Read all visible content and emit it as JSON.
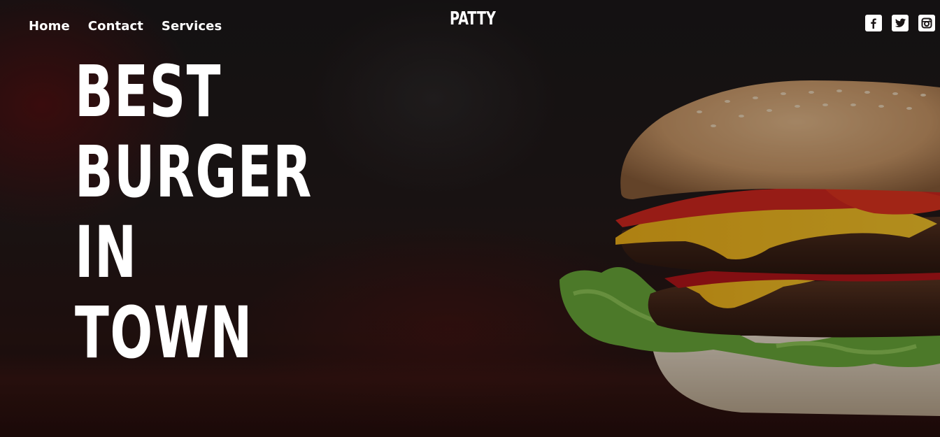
{
  "nav": {
    "items": [
      {
        "label": "Home"
      },
      {
        "label": "Contact"
      },
      {
        "label": "Services"
      }
    ]
  },
  "brand": {
    "logo_text": "PATTY"
  },
  "social": {
    "icons": [
      "facebook-icon",
      "twitter-icon",
      "instagram-icon"
    ]
  },
  "hero": {
    "headline_lines": [
      "BEST",
      "BURGER",
      "IN",
      "TOWN"
    ],
    "image_subject": "burger-photo"
  },
  "colors": {
    "text": "#ffffff",
    "background": "#1a1516",
    "accent_red": "#7a0c0e"
  }
}
